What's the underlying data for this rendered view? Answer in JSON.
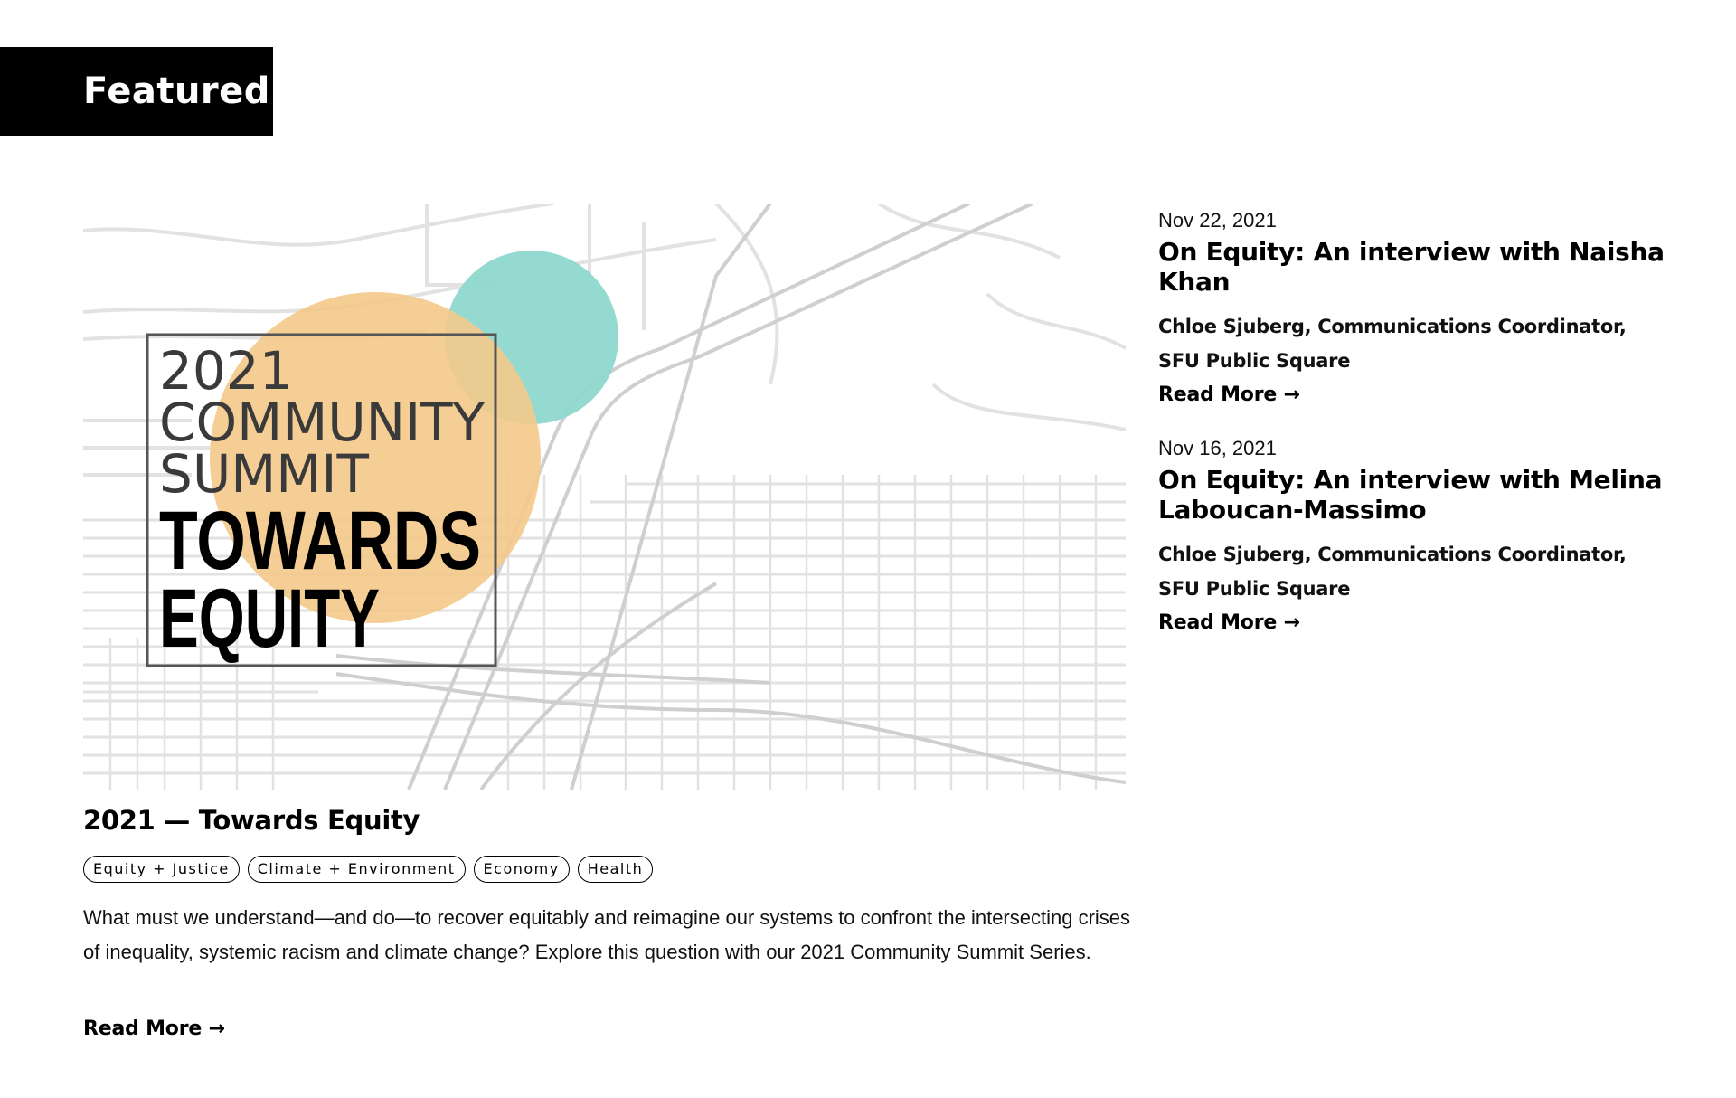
{
  "section": {
    "label": "Featured"
  },
  "feature": {
    "image": {
      "alt": "2021 Community Summit Towards Equity",
      "line1": "2021",
      "line2": "COMMUNITY",
      "line3": "SUMMIT",
      "line4": "TOWARDS",
      "line5": "EQUITY",
      "colors": {
        "peach": "#F3C98A",
        "teal": "#8ED8CF",
        "map": "#DADADA"
      }
    },
    "title": "2021 — Towards Equity",
    "tags": [
      "Equity + Justice",
      "Climate + Environment",
      "Economy",
      "Health"
    ],
    "description": "What must we understand—and do—to recover equitably and reimagine our systems to confront the intersecting crises of inequality, systemic racism and climate change? Explore this question with our 2021 Community Summit Series.",
    "read_more": "Read More →"
  },
  "articles": [
    {
      "date": "Nov 22, 2021",
      "title": "On Equity: An interview with Naisha Khan",
      "author": "Chloe Sjuberg, Communications Coordinator, SFU Public Square",
      "read_more": "Read More →"
    },
    {
      "date": "Nov 16, 2021",
      "title": "On Equity: An interview with Melina Laboucan-Massimo",
      "author": "Chloe Sjuberg, Communications Coordinator, SFU Public Square",
      "read_more": "Read More →"
    }
  ]
}
